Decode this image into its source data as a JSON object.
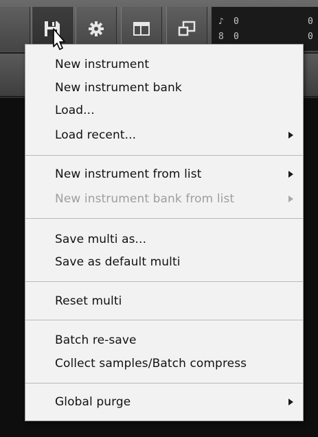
{
  "toolbar": {
    "buttons": [
      {
        "name": "save",
        "icon": "floppy-disk-icon"
      },
      {
        "name": "options",
        "icon": "gear-icon"
      },
      {
        "name": "view",
        "icon": "layout-icon"
      },
      {
        "name": "window",
        "icon": "restore-window-icon"
      }
    ],
    "meter": {
      "voices_top": "0",
      "voices_bottom": "0",
      "right_top": "0",
      "right_bottom": "0"
    }
  },
  "menu": {
    "items": [
      {
        "label": "New instrument",
        "submenu": false,
        "disabled": false
      },
      {
        "label": "New instrument bank",
        "submenu": false,
        "disabled": false
      },
      {
        "label": "Load...",
        "submenu": false,
        "disabled": false
      },
      {
        "label": "Load recent...",
        "submenu": true,
        "disabled": false
      },
      {
        "label": "New instrument from list",
        "submenu": true,
        "disabled": false
      },
      {
        "label": "New instrument bank from list",
        "submenu": true,
        "disabled": true
      },
      {
        "label": "Save multi as...",
        "submenu": false,
        "disabled": false
      },
      {
        "label": "Save as default multi",
        "submenu": false,
        "disabled": false
      },
      {
        "label": "Reset multi",
        "submenu": false,
        "disabled": false
      },
      {
        "label": "Batch re-save",
        "submenu": false,
        "disabled": false
      },
      {
        "label": "Collect samples/Batch compress",
        "submenu": false,
        "disabled": false
      },
      {
        "label": "Global purge",
        "submenu": true,
        "disabled": false
      }
    ]
  },
  "colors": {
    "menu_bg": "#f2f2f2",
    "menu_text": "#111111",
    "disabled_text": "#9e9e9e",
    "toolbar": "#555555"
  }
}
